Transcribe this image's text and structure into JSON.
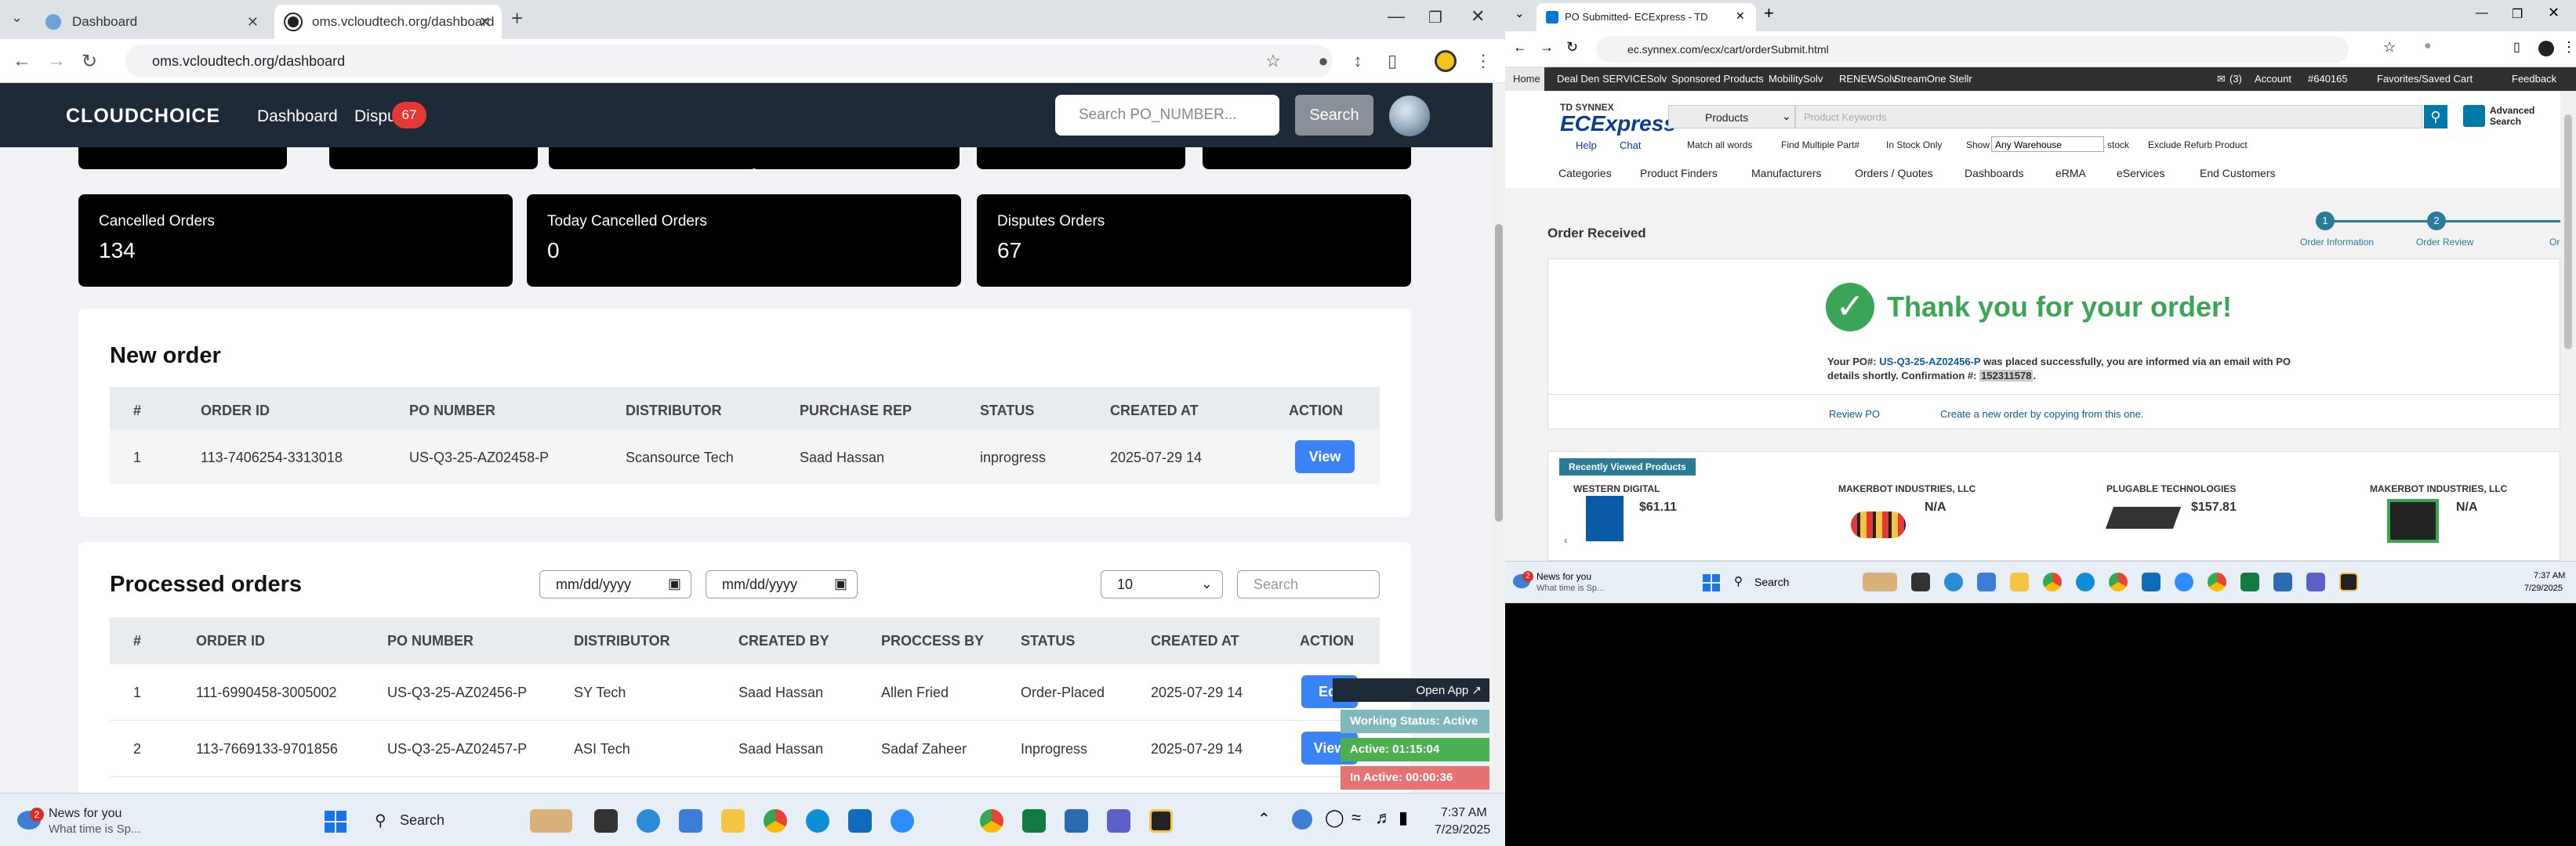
{
  "left": {
    "tabs": [
      {
        "title": "Dashboard"
      },
      {
        "title": "oms.vcloudtech.org/dashboard"
      }
    ],
    "url": "oms.vcloudtech.org/dashboard",
    "brand": "CLOUDCHOICE",
    "nav": {
      "dashboard": "Dashboard",
      "disputes": "Dispu",
      "disputes_badge": "67"
    },
    "search": {
      "placeholder": "Search PO_NUMBER...",
      "button": "Search"
    },
    "stats": [
      {
        "label": "Cancelled Orders",
        "value": "134"
      },
      {
        "label": "Today Cancelled Orders",
        "value": "0"
      },
      {
        "label": "Disputes Orders",
        "value": "67"
      }
    ],
    "new_order": {
      "title": "New order",
      "columns": [
        "#",
        "ORDER ID",
        "PO NUMBER",
        "DISTRIBUTOR",
        "PURCHASE REP",
        "STATUS",
        "CREATED AT",
        "ACTION"
      ],
      "rows": [
        {
          "n": "1",
          "order_id": "113-7406254-3313018",
          "po": "US-Q3-25-AZ02458-P",
          "distributor": "Scansource Tech",
          "rep": "Saad Hassan",
          "status": "inprogress",
          "created": "2025-07-29 14",
          "action": "View"
        }
      ]
    },
    "processed": {
      "title": "Processed orders",
      "date_from": "mm/dd/yyyy",
      "date_to": "mm/dd/yyyy",
      "page_size": "10",
      "search_placeholder": "Search",
      "columns": [
        "#",
        "ORDER ID",
        "PO NUMBER",
        "DISTRIBUTOR",
        "CREATED BY",
        "PROCCESS BY",
        "STATUS",
        "CREATED AT",
        "ACTION"
      ],
      "rows": [
        {
          "n": "1",
          "order_id": "111-6990458-3005002",
          "po": "US-Q3-25-AZ02456-P",
          "distributor": "SY Tech",
          "created_by": "Saad Hassan",
          "process_by": "Allen Fried",
          "status": "Order-Placed",
          "created": "2025-07-29 14",
          "action": "Edi"
        },
        {
          "n": "2",
          "order_id": "113-7669133-9701856",
          "po": "US-Q3-25-AZ02457-P",
          "distributor": "ASI Tech",
          "created_by": "Saad Hassan",
          "process_by": "Sadaf Zaheer",
          "status": "Inprogress",
          "created": "2025-07-29 14",
          "action": "View"
        }
      ]
    },
    "widget": {
      "open_app": "Open App ↗",
      "working": "Working Status: Active",
      "active": "Active: 01:15:04",
      "inactive": "In Active: 00:00:36"
    },
    "taskbar": {
      "news_title": "News for you",
      "news_sub": "What time is Sp...",
      "search": "Search",
      "time": "7:37 AM",
      "date": "7/29/2025",
      "news_badge": "2"
    }
  },
  "right": {
    "tab": "PO Submitted- ECExpress - TD",
    "url": "ec.synnex.com/ecx/cart/orderSubmit.html",
    "topnav": [
      "Home",
      "Deal Den",
      "SERVICESolv",
      "Sponsored Products",
      "MobilitySolv",
      "RENEWSolv",
      "StreamOne Stellr"
    ],
    "account": {
      "msg": "(3)",
      "account": "Account",
      "id": "#640165",
      "fav": "Favorites/Saved Cart",
      "feedback": "Feedback"
    },
    "brand_top": "TD SYNNEX",
    "brand": "ECExpress",
    "search_select": "Products",
    "search_placeholder": "Product Keywords",
    "advanced": "Advanced Search",
    "help": "Help",
    "chat": "Chat",
    "options": {
      "match": "Match all words",
      "multi": "Find Multiple Part#",
      "instock": "In Stock Only",
      "show": "Show",
      "warehouse": "Any Warehouse",
      "stock": "stock",
      "exclude": "Exclude Refurb Product"
    },
    "categories": [
      "Categories",
      "Product Finders",
      "Manufacturers",
      "Orders / Quotes",
      "Dashboards",
      "eRMA",
      "eServices",
      "End Customers"
    ],
    "order_received": "Order Received",
    "steps": [
      {
        "n": "1",
        "label": "Order Information"
      },
      {
        "n": "2",
        "label": "Order Review"
      },
      {
        "n": "",
        "label": "Or"
      }
    ],
    "thank": "Thank you for your order!",
    "msg_prefix": "Your PO#:",
    "po": "US-Q3-25-AZ02456-P",
    "msg_mid": "was placed successfully, you are informed via an email with PO",
    "msg_line2": "details shortly. Confirmation #:",
    "confirmation": "152311578",
    "review_po": "Review PO",
    "create_new": "Create a new order by copying from this one.",
    "recent": "Recently Viewed Products",
    "products": [
      {
        "vendor": "WESTERN DIGITAL",
        "price": "$61.11"
      },
      {
        "vendor": "MAKERBOT INDUSTRIES, LLC",
        "price": "N/A"
      },
      {
        "vendor": "PLUGABLE TECHNOLOGIES",
        "price": "$157.81"
      },
      {
        "vendor": "MAKERBOT INDUSTRIES, LLC",
        "price": "N/A"
      }
    ],
    "taskbar": {
      "news_title": "News for you",
      "news_sub": "What time is Sp...",
      "search": "Search",
      "time": "7:37 AM",
      "date": "7/29/2025",
      "news_badge": "2"
    }
  }
}
